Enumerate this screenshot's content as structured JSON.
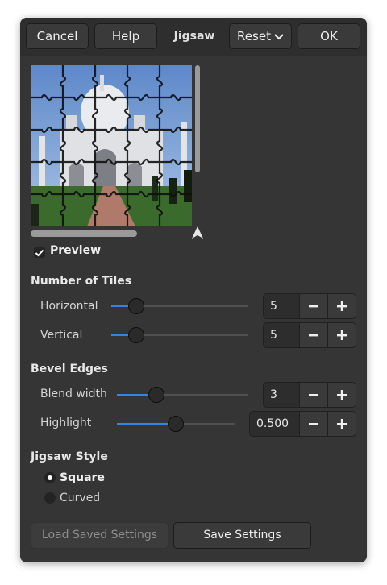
{
  "header": {
    "cancel_label": "Cancel",
    "help_label": "Help",
    "title": "Jigsaw",
    "reset_label": "Reset",
    "ok_label": "OK"
  },
  "preview": {
    "checkbox_label": "Preview",
    "checked": true
  },
  "tiles": {
    "section_label": "Number of Tiles",
    "horizontal": {
      "label": "Horizontal",
      "value": "5",
      "fraction": 0.18
    },
    "vertical": {
      "label": "Vertical",
      "value": "5",
      "fraction": 0.18
    }
  },
  "bevel": {
    "section_label": "Bevel Edges",
    "blend_width": {
      "label": "Blend width",
      "value": "3",
      "fraction": 0.3
    },
    "highlight": {
      "label": "Highlight",
      "value": "0.500",
      "fraction": 0.5
    }
  },
  "style": {
    "section_label": "Jigsaw Style",
    "options": [
      {
        "label": "Square",
        "selected": true
      },
      {
        "label": "Curved",
        "selected": false
      }
    ]
  },
  "buttons": {
    "load_label": "Load Saved Settings",
    "save_label": "Save Settings"
  },
  "colors": {
    "accent": "#3584e4",
    "background": "#353535",
    "header": "#2e2e2e"
  },
  "icons": [
    "check-icon",
    "chevron-down-icon",
    "minus-icon",
    "plus-icon",
    "navigate-arrow-icon"
  ]
}
